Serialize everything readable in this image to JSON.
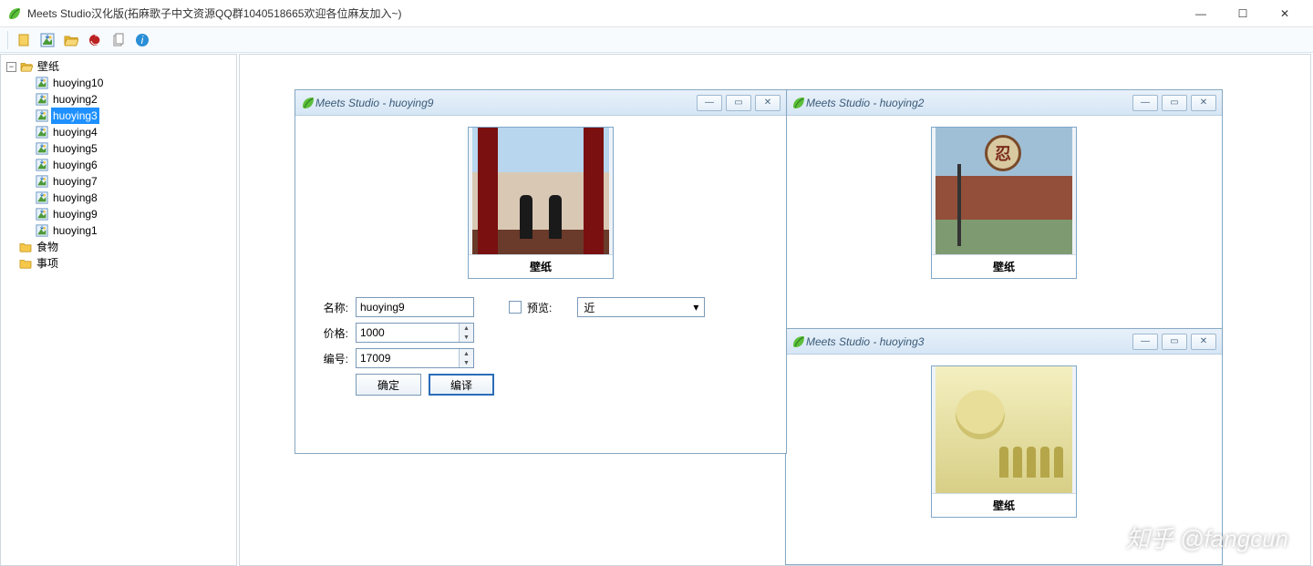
{
  "app": {
    "title": "Meets Studio汉化版(拓麻歌子中文资源QQ群1040518665欢迎各位麻友加入~)"
  },
  "toolbar": {
    "icons": [
      "yellow-doc-icon",
      "image-down-icon",
      "folder-open-icon",
      "swirl-icon",
      "card-icon",
      "info-icon"
    ]
  },
  "tree": {
    "root": "壁纸",
    "items": [
      "huoying10",
      "huoying2",
      "huoying3",
      "huoying4",
      "huoying5",
      "huoying6",
      "huoying7",
      "huoying8",
      "huoying9",
      "huoying1"
    ],
    "selected": "huoying3",
    "siblings": [
      "食物",
      "事项"
    ]
  },
  "childBase": "Meets Studio - ",
  "preview_caption": "壁纸",
  "windows": {
    "active": {
      "name": "huoying9"
    },
    "back1": {
      "name": "huoying2"
    },
    "back2": {
      "name": "huoying3"
    }
  },
  "form": {
    "name_label": "名称:",
    "price_label": "价格:",
    "id_label": "编号:",
    "preview_label": "预览:",
    "name_value": "huoying9",
    "price_value": "1000",
    "id_value": "17009",
    "distance_value": "近",
    "ok": "确定",
    "compile": "编译"
  },
  "watermark": "知乎 @fangcun"
}
